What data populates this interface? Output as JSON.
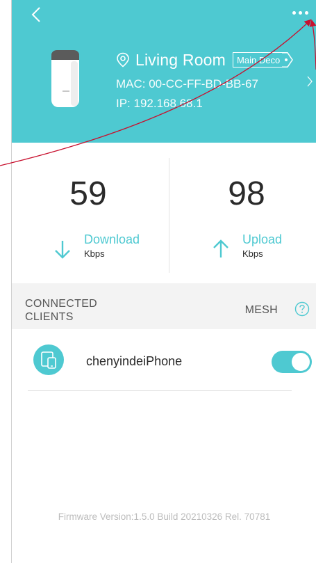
{
  "header": {
    "room_name": "Living Room",
    "badge": "Main Deco",
    "mac": "MAC: 00-CC-FF-BD-BB-67",
    "ip": "IP: 192.168.68.1"
  },
  "stats": {
    "download": {
      "value": "59",
      "label": "Download",
      "unit": "Kbps"
    },
    "upload": {
      "value": "98",
      "label": "Upload",
      "unit": "Kbps"
    }
  },
  "section": {
    "line1": "CONNECTED",
    "line2": "CLIENTS",
    "mesh": "MESH"
  },
  "clients": [
    {
      "name": "chenyindeiPhone",
      "enabled": true
    }
  ],
  "footer": {
    "firmware": "Firmware Version:1.5.0 Build 20210326 Rel. 70781"
  },
  "colors": {
    "accent": "#4ec9d1",
    "annotation": "#c8102e"
  },
  "icons": [
    "back-icon",
    "more-icon",
    "location-pin-icon",
    "chevron-right-icon",
    "download-arrow-icon",
    "upload-arrow-icon",
    "help-icon",
    "devices-icon"
  ]
}
